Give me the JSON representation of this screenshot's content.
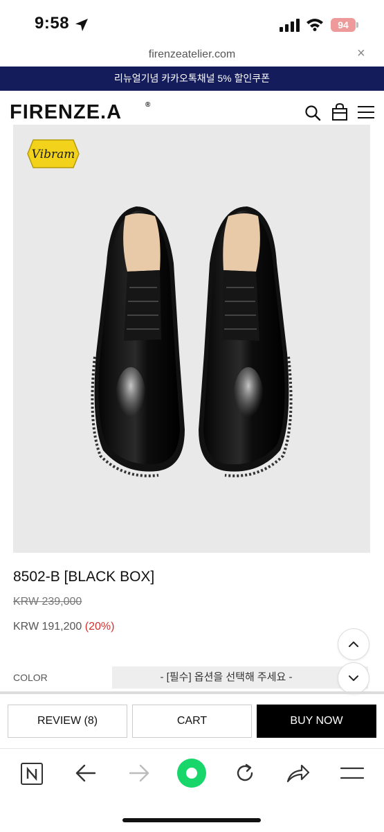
{
  "status_bar": {
    "time": "9:58",
    "battery": "94"
  },
  "url_bar": {
    "url": "firenzeatelier.com",
    "close_label": "×"
  },
  "promo": {
    "text": "리뉴얼기념 카카오톡채널 5% 할인쿠폰"
  },
  "header": {
    "logo": "FIRENZE.A",
    "logo_mark": "®"
  },
  "product": {
    "badge": "Vibram",
    "name": "8502-B [BLACK BOX]",
    "original_price": "KRW 239,000",
    "sale_price": "KRW 191,200",
    "discount": "(20%)"
  },
  "options": {
    "label": "COLOR",
    "placeholder": "- [필수] 옵션을 선택해 주세요 -"
  },
  "actions": {
    "review": "REVIEW (8)",
    "cart": "CART",
    "buy": "BUY NOW"
  },
  "colors": {
    "promo_bg": "#141c5c",
    "discount": "#d32f2f",
    "accent_green": "#19d66a",
    "badge_yellow": "#f2d21b"
  }
}
